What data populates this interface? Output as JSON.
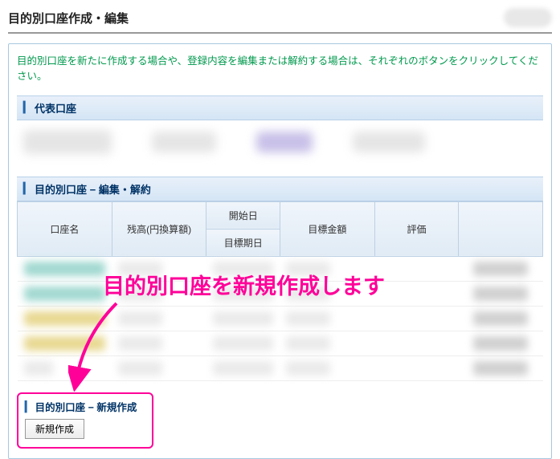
{
  "page": {
    "title": "目的別口座作成・編集"
  },
  "instruction": "目的別口座を新たに作成する場合や、登録内容を編集または解約する場合は、それぞれのボタンをクリックしてください。",
  "sections": {
    "representative": "代表口座",
    "editCancel": "目的別口座 − 編集・解約",
    "newCreate": "目的別口座 − 新規作成"
  },
  "table": {
    "columns": {
      "accountName": "口座名",
      "balance": "残高(円換算額)",
      "startDate": "開始日",
      "targetDate": "目標期日",
      "targetAmount": "目標金額",
      "evaluation": "評価"
    }
  },
  "buttons": {
    "create": "新規作成"
  },
  "annotation": {
    "text": "目的別口座を新規作成します"
  }
}
